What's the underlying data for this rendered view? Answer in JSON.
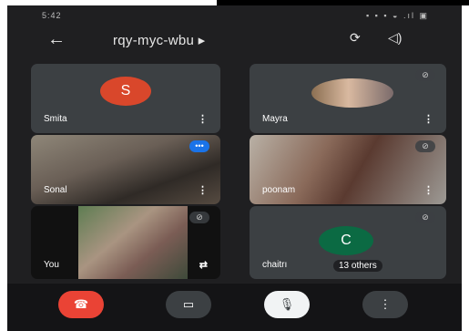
{
  "status": {
    "time": "5:42",
    "icons": "▪ ▪ ▪ ◒ .ıl ▣"
  },
  "header": {
    "back_icon": "←",
    "meeting_code": "rqy-myc-wbu ▸",
    "camera_switch_icon": "⟳",
    "speaker_icon": "◁)"
  },
  "tiles": [
    {
      "name": "Smita",
      "avatar_letter": "S",
      "avatar_color": "#d9472b"
    },
    {
      "name": "Mayra"
    },
    {
      "name": "Sonal"
    },
    {
      "name": "poonam"
    },
    {
      "name": "You"
    },
    {
      "name": "chaitrı",
      "avatar_letter": "C",
      "avatar_color": "#0b6a43",
      "others_label": "13 others"
    }
  ],
  "controls": {
    "end_call_color": "#ea4335",
    "camera_icon": "▭",
    "mic_icon": "🎙",
    "more_icon": "⋮"
  }
}
